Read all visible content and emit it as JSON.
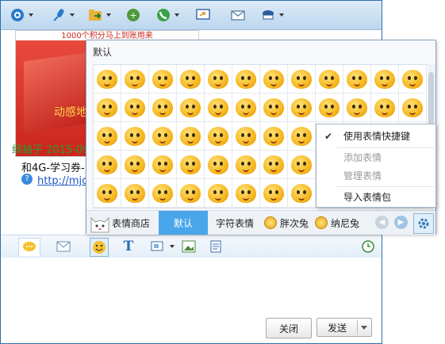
{
  "chat": {
    "banner_top_text": "1000个积分马上到账用来",
    "banner_text": "动感地",
    "sender_line": "绿袖子 2015-09",
    "message_line": "和4G-学习券-",
    "link_text": "http://mjo"
  },
  "emoji_panel": {
    "title": "默认",
    "rows": 5,
    "cols": 12,
    "tabs": {
      "store": "表情商店",
      "default": "默认",
      "text_emoji": "字符表情",
      "pack1": "胖次兔",
      "pack2": "纳尼兔"
    }
  },
  "context_menu": {
    "use_shortcut": "使用表情快捷键",
    "add": "添加表情",
    "manage": "管理表情",
    "import": "导入表情包"
  },
  "footer": {
    "close_label": "关闭",
    "send_label": "发送"
  },
  "colors": {
    "accent": "#4aa6ea",
    "window_border": "#2f6ea8",
    "sender_green": "#2d9b2d"
  }
}
